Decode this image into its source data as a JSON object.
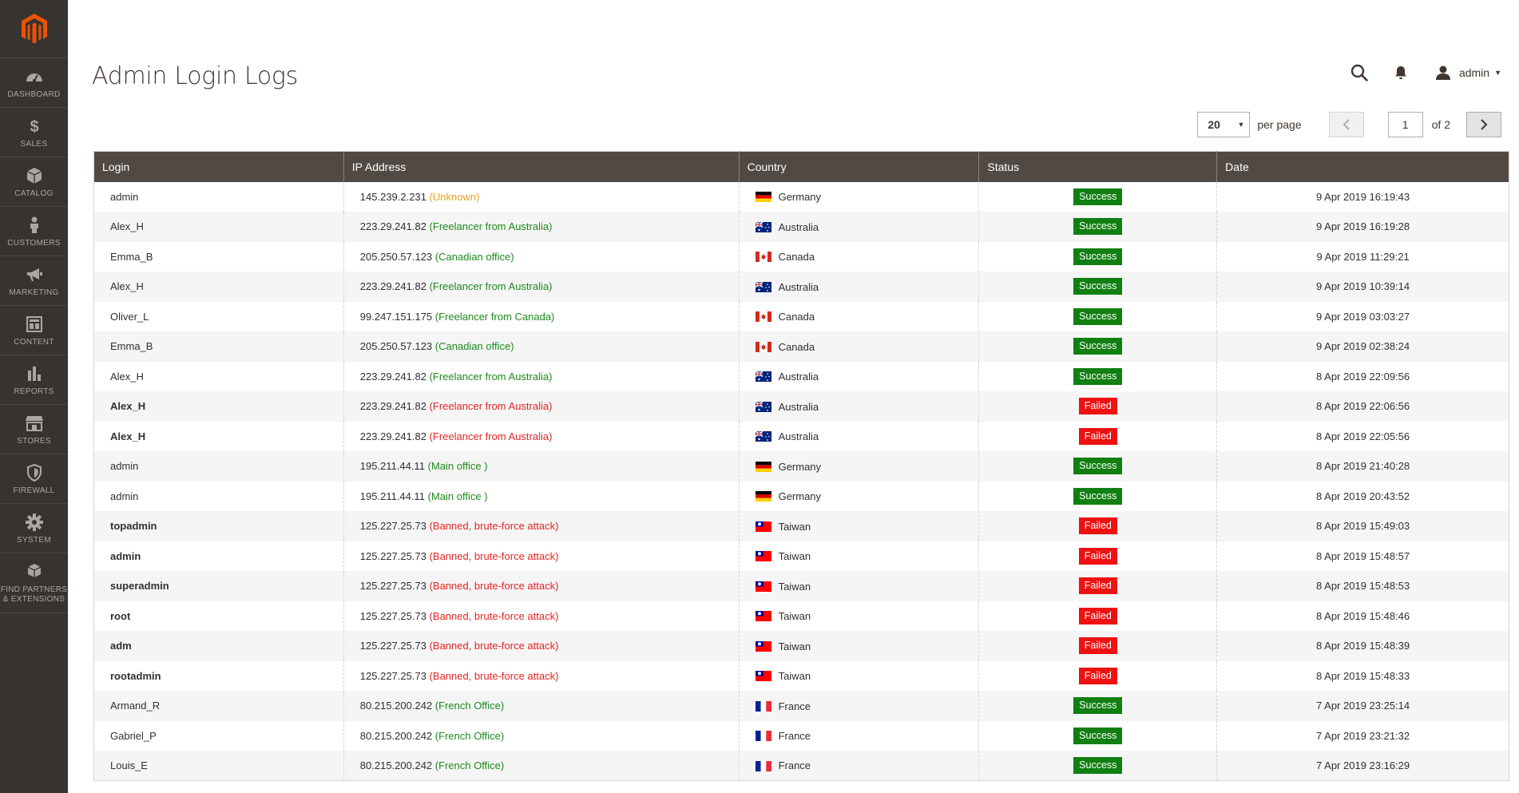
{
  "colors": {
    "sidebar_bg": "#373330",
    "brand": "#eb5202",
    "header_bg": "#514943",
    "success": "#117f11",
    "failed": "#ee1111",
    "note_green": "#1d8a1d",
    "note_red": "#e22626",
    "note_orange": "#e6a11d"
  },
  "sidebar": {
    "items": [
      {
        "label": "DASHBOARD",
        "icon": "dashboard-icon"
      },
      {
        "label": "SALES",
        "icon": "dollar-icon"
      },
      {
        "label": "CATALOG",
        "icon": "box-icon"
      },
      {
        "label": "CUSTOMERS",
        "icon": "person-icon"
      },
      {
        "label": "MARKETING",
        "icon": "megaphone-icon"
      },
      {
        "label": "CONTENT",
        "icon": "content-icon"
      },
      {
        "label": "REPORTS",
        "icon": "bar-chart-icon"
      },
      {
        "label": "STORES",
        "icon": "store-icon"
      },
      {
        "label": "FIREWALL",
        "icon": "shield-icon"
      },
      {
        "label": "SYSTEM",
        "icon": "gear-icon"
      },
      {
        "label": "FIND PARTNERS & EXTENSIONS",
        "icon": "boxes-icon"
      }
    ]
  },
  "header": {
    "title": "Admin Login Logs",
    "user": "admin"
  },
  "pager": {
    "per_page": "20",
    "per_page_label": "per page",
    "current_page": "1",
    "of_pages": "of 2"
  },
  "table": {
    "columns": [
      "Login",
      "IP Address",
      "Country",
      "Status",
      "Date"
    ],
    "rows": [
      {
        "login": "admin",
        "bold": false,
        "ip": "145.239.2.231",
        "note": "(Unknown)",
        "note_color": "orange",
        "country": "Germany",
        "flag": "de",
        "status": "Success",
        "date": "9 Apr 2019 16:19:43"
      },
      {
        "login": "Alex_H",
        "bold": false,
        "ip": "223.29.241.82",
        "note": "(Freelancer from Australia)",
        "note_color": "green",
        "country": "Australia",
        "flag": "au",
        "status": "Success",
        "date": "9 Apr 2019 16:19:28"
      },
      {
        "login": "Emma_B",
        "bold": false,
        "ip": "205.250.57.123",
        "note": "(Canadian office)",
        "note_color": "green",
        "country": "Canada",
        "flag": "ca",
        "status": "Success",
        "date": "9 Apr 2019 11:29:21"
      },
      {
        "login": "Alex_H",
        "bold": false,
        "ip": "223.29.241.82",
        "note": "(Freelancer from Australia)",
        "note_color": "green",
        "country": "Australia",
        "flag": "au",
        "status": "Success",
        "date": "9 Apr 2019 10:39:14"
      },
      {
        "login": "Oliver_L",
        "bold": false,
        "ip": "99.247.151.175",
        "note": "(Freelancer from Canada)",
        "note_color": "green",
        "country": "Canada",
        "flag": "ca",
        "status": "Success",
        "date": "9 Apr 2019 03:03:27"
      },
      {
        "login": "Emma_B",
        "bold": false,
        "ip": "205.250.57.123",
        "note": "(Canadian office)",
        "note_color": "green",
        "country": "Canada",
        "flag": "ca",
        "status": "Success",
        "date": "9 Apr 2019 02:38:24"
      },
      {
        "login": "Alex_H",
        "bold": false,
        "ip": "223.29.241.82",
        "note": "(Freelancer from Australia)",
        "note_color": "green",
        "country": "Australia",
        "flag": "au",
        "status": "Success",
        "date": "8 Apr 2019 22:09:56"
      },
      {
        "login": "Alex_H",
        "bold": true,
        "ip": "223.29.241.82",
        "note": "(Freelancer from Australia)",
        "note_color": "red",
        "country": "Australia",
        "flag": "au",
        "status": "Failed",
        "date": "8 Apr 2019 22:06:56"
      },
      {
        "login": "Alex_H",
        "bold": true,
        "ip": "223.29.241.82",
        "note": "(Freelancer from Australia)",
        "note_color": "red",
        "country": "Australia",
        "flag": "au",
        "status": "Failed",
        "date": "8 Apr 2019 22:05:56"
      },
      {
        "login": "admin",
        "bold": false,
        "ip": "195.211.44.11",
        "note": "(Main office )",
        "note_color": "green",
        "country": "Germany",
        "flag": "de",
        "status": "Success",
        "date": "8 Apr 2019 21:40:28"
      },
      {
        "login": "admin",
        "bold": false,
        "ip": "195.211.44.11",
        "note": "(Main office )",
        "note_color": "green",
        "country": "Germany",
        "flag": "de",
        "status": "Success",
        "date": "8 Apr 2019 20:43:52"
      },
      {
        "login": "topadmin",
        "bold": true,
        "ip": "125.227.25.73",
        "note": "(Banned, brute-force attack)",
        "note_color": "red",
        "country": "Taiwan",
        "flag": "tw",
        "status": "Failed",
        "date": "8 Apr 2019 15:49:03"
      },
      {
        "login": "admin",
        "bold": true,
        "ip": "125.227.25.73",
        "note": "(Banned, brute-force attack)",
        "note_color": "red",
        "country": "Taiwan",
        "flag": "tw",
        "status": "Failed",
        "date": "8 Apr 2019 15:48:57"
      },
      {
        "login": "superadmin",
        "bold": true,
        "ip": "125.227.25.73",
        "note": "(Banned, brute-force attack)",
        "note_color": "red",
        "country": "Taiwan",
        "flag": "tw",
        "status": "Failed",
        "date": "8 Apr 2019 15:48:53"
      },
      {
        "login": "root",
        "bold": true,
        "ip": "125.227.25.73",
        "note": "(Banned, brute-force attack)",
        "note_color": "red",
        "country": "Taiwan",
        "flag": "tw",
        "status": "Failed",
        "date": "8 Apr 2019 15:48:46"
      },
      {
        "login": "adm",
        "bold": true,
        "ip": "125.227.25.73",
        "note": "(Banned, brute-force attack)",
        "note_color": "red",
        "country": "Taiwan",
        "flag": "tw",
        "status": "Failed",
        "date": "8 Apr 2019 15:48:39"
      },
      {
        "login": "rootadmin",
        "bold": true,
        "ip": "125.227.25.73",
        "note": "(Banned, brute-force attack)",
        "note_color": "red",
        "country": "Taiwan",
        "flag": "tw",
        "status": "Failed",
        "date": "8 Apr 2019 15:48:33"
      },
      {
        "login": "Armand_R",
        "bold": false,
        "ip": "80.215.200.242",
        "note": " (French Office)",
        "note_color": "green",
        "country": "France",
        "flag": "fr",
        "status": "Success",
        "date": "7 Apr 2019 23:25:14"
      },
      {
        "login": "Gabriel_P",
        "bold": false,
        "ip": "80.215.200.242",
        "note": " (French Office)",
        "note_color": "green",
        "country": "France",
        "flag": "fr",
        "status": "Success",
        "date": "7 Apr 2019 23:21:32"
      },
      {
        "login": "Louis_E",
        "bold": false,
        "ip": "80.215.200.242",
        "note": " (French Office)",
        "note_color": "green",
        "country": "France",
        "flag": "fr",
        "status": "Success",
        "date": "7 Apr 2019 23:16:29"
      }
    ]
  }
}
